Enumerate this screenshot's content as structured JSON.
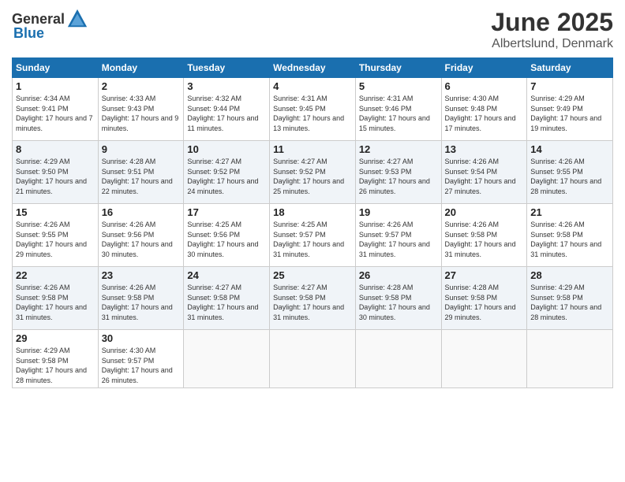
{
  "header": {
    "logo_general": "General",
    "logo_blue": "Blue",
    "month": "June 2025",
    "location": "Albertslund, Denmark"
  },
  "weekdays": [
    "Sunday",
    "Monday",
    "Tuesday",
    "Wednesday",
    "Thursday",
    "Friday",
    "Saturday"
  ],
  "weeks": [
    [
      {
        "day": "1",
        "sunrise": "Sunrise: 4:34 AM",
        "sunset": "Sunset: 9:41 PM",
        "daylight": "Daylight: 17 hours and 7 minutes."
      },
      {
        "day": "2",
        "sunrise": "Sunrise: 4:33 AM",
        "sunset": "Sunset: 9:43 PM",
        "daylight": "Daylight: 17 hours and 9 minutes."
      },
      {
        "day": "3",
        "sunrise": "Sunrise: 4:32 AM",
        "sunset": "Sunset: 9:44 PM",
        "daylight": "Daylight: 17 hours and 11 minutes."
      },
      {
        "day": "4",
        "sunrise": "Sunrise: 4:31 AM",
        "sunset": "Sunset: 9:45 PM",
        "daylight": "Daylight: 17 hours and 13 minutes."
      },
      {
        "day": "5",
        "sunrise": "Sunrise: 4:31 AM",
        "sunset": "Sunset: 9:46 PM",
        "daylight": "Daylight: 17 hours and 15 minutes."
      },
      {
        "day": "6",
        "sunrise": "Sunrise: 4:30 AM",
        "sunset": "Sunset: 9:48 PM",
        "daylight": "Daylight: 17 hours and 17 minutes."
      },
      {
        "day": "7",
        "sunrise": "Sunrise: 4:29 AM",
        "sunset": "Sunset: 9:49 PM",
        "daylight": "Daylight: 17 hours and 19 minutes."
      }
    ],
    [
      {
        "day": "8",
        "sunrise": "Sunrise: 4:29 AM",
        "sunset": "Sunset: 9:50 PM",
        "daylight": "Daylight: 17 hours and 21 minutes."
      },
      {
        "day": "9",
        "sunrise": "Sunrise: 4:28 AM",
        "sunset": "Sunset: 9:51 PM",
        "daylight": "Daylight: 17 hours and 22 minutes."
      },
      {
        "day": "10",
        "sunrise": "Sunrise: 4:27 AM",
        "sunset": "Sunset: 9:52 PM",
        "daylight": "Daylight: 17 hours and 24 minutes."
      },
      {
        "day": "11",
        "sunrise": "Sunrise: 4:27 AM",
        "sunset": "Sunset: 9:52 PM",
        "daylight": "Daylight: 17 hours and 25 minutes."
      },
      {
        "day": "12",
        "sunrise": "Sunrise: 4:27 AM",
        "sunset": "Sunset: 9:53 PM",
        "daylight": "Daylight: 17 hours and 26 minutes."
      },
      {
        "day": "13",
        "sunrise": "Sunrise: 4:26 AM",
        "sunset": "Sunset: 9:54 PM",
        "daylight": "Daylight: 17 hours and 27 minutes."
      },
      {
        "day": "14",
        "sunrise": "Sunrise: 4:26 AM",
        "sunset": "Sunset: 9:55 PM",
        "daylight": "Daylight: 17 hours and 28 minutes."
      }
    ],
    [
      {
        "day": "15",
        "sunrise": "Sunrise: 4:26 AM",
        "sunset": "Sunset: 9:55 PM",
        "daylight": "Daylight: 17 hours and 29 minutes."
      },
      {
        "day": "16",
        "sunrise": "Sunrise: 4:26 AM",
        "sunset": "Sunset: 9:56 PM",
        "daylight": "Daylight: 17 hours and 30 minutes."
      },
      {
        "day": "17",
        "sunrise": "Sunrise: 4:25 AM",
        "sunset": "Sunset: 9:56 PM",
        "daylight": "Daylight: 17 hours and 30 minutes."
      },
      {
        "day": "18",
        "sunrise": "Sunrise: 4:25 AM",
        "sunset": "Sunset: 9:57 PM",
        "daylight": "Daylight: 17 hours and 31 minutes."
      },
      {
        "day": "19",
        "sunrise": "Sunrise: 4:26 AM",
        "sunset": "Sunset: 9:57 PM",
        "daylight": "Daylight: 17 hours and 31 minutes."
      },
      {
        "day": "20",
        "sunrise": "Sunrise: 4:26 AM",
        "sunset": "Sunset: 9:58 PM",
        "daylight": "Daylight: 17 hours and 31 minutes."
      },
      {
        "day": "21",
        "sunrise": "Sunrise: 4:26 AM",
        "sunset": "Sunset: 9:58 PM",
        "daylight": "Daylight: 17 hours and 31 minutes."
      }
    ],
    [
      {
        "day": "22",
        "sunrise": "Sunrise: 4:26 AM",
        "sunset": "Sunset: 9:58 PM",
        "daylight": "Daylight: 17 hours and 31 minutes."
      },
      {
        "day": "23",
        "sunrise": "Sunrise: 4:26 AM",
        "sunset": "Sunset: 9:58 PM",
        "daylight": "Daylight: 17 hours and 31 minutes."
      },
      {
        "day": "24",
        "sunrise": "Sunrise: 4:27 AM",
        "sunset": "Sunset: 9:58 PM",
        "daylight": "Daylight: 17 hours and 31 minutes."
      },
      {
        "day": "25",
        "sunrise": "Sunrise: 4:27 AM",
        "sunset": "Sunset: 9:58 PM",
        "daylight": "Daylight: 17 hours and 31 minutes."
      },
      {
        "day": "26",
        "sunrise": "Sunrise: 4:28 AM",
        "sunset": "Sunset: 9:58 PM",
        "daylight": "Daylight: 17 hours and 30 minutes."
      },
      {
        "day": "27",
        "sunrise": "Sunrise: 4:28 AM",
        "sunset": "Sunset: 9:58 PM",
        "daylight": "Daylight: 17 hours and 29 minutes."
      },
      {
        "day": "28",
        "sunrise": "Sunrise: 4:29 AM",
        "sunset": "Sunset: 9:58 PM",
        "daylight": "Daylight: 17 hours and 28 minutes."
      }
    ],
    [
      {
        "day": "29",
        "sunrise": "Sunrise: 4:29 AM",
        "sunset": "Sunset: 9:58 PM",
        "daylight": "Daylight: 17 hours and 28 minutes."
      },
      {
        "day": "30",
        "sunrise": "Sunrise: 4:30 AM",
        "sunset": "Sunset: 9:57 PM",
        "daylight": "Daylight: 17 hours and 26 minutes."
      },
      null,
      null,
      null,
      null,
      null
    ]
  ]
}
